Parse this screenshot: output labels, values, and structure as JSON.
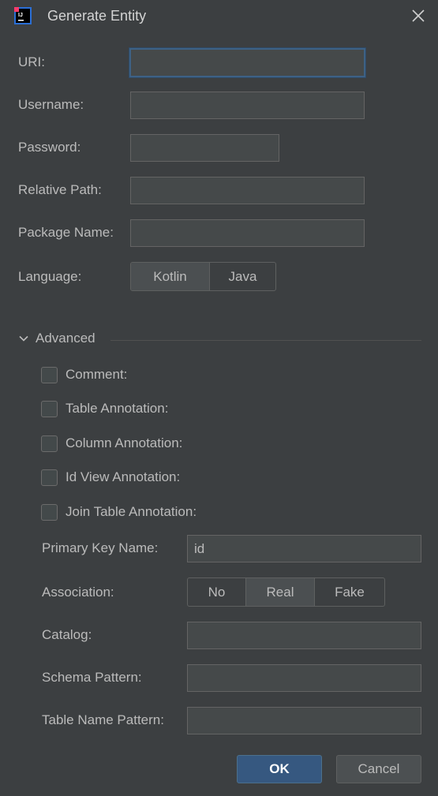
{
  "window": {
    "title": "Generate Entity"
  },
  "form": {
    "uri_label": "URI:",
    "uri_value": "",
    "username_label": "Username:",
    "username_value": "",
    "password_label": "Password:",
    "password_value": "",
    "relative_path_label": "Relative Path:",
    "relative_path_value": "",
    "package_name_label": "Package Name:",
    "package_name_value": "",
    "language_label": "Language:",
    "language_options": [
      "Kotlin",
      "Java"
    ],
    "language_selected": "Kotlin"
  },
  "advanced": {
    "header": "Advanced",
    "checkboxes": [
      {
        "label": "Comment:",
        "checked": false
      },
      {
        "label": "Table Annotation:",
        "checked": false
      },
      {
        "label": "Column Annotation:",
        "checked": false
      },
      {
        "label": "Id View Annotation:",
        "checked": false
      },
      {
        "label": "Join Table Annotation:",
        "checked": false
      }
    ],
    "primary_key_label": "Primary Key Name:",
    "primary_key_value": "id",
    "association_label": "Association:",
    "association_options": [
      "No",
      "Real",
      "Fake"
    ],
    "association_selected": "Real",
    "catalog_label": "Catalog:",
    "catalog_value": "",
    "schema_pattern_label": "Schema Pattern:",
    "schema_pattern_value": "",
    "table_name_pattern_label": "Table Name Pattern:",
    "table_name_pattern_value": ""
  },
  "buttons": {
    "ok": "OK",
    "cancel": "Cancel"
  },
  "colors": {
    "background": "#3c3f41",
    "focus_border": "#3d6185",
    "primary_button": "#365880"
  }
}
